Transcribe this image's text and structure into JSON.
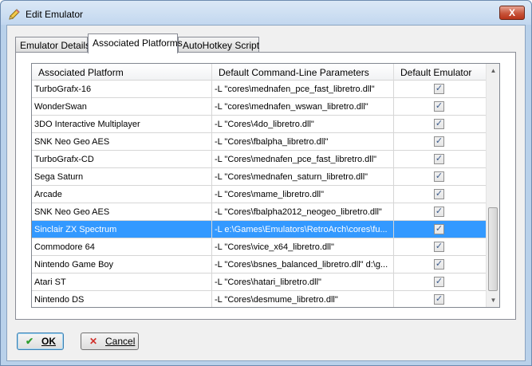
{
  "window": {
    "title": "Edit Emulator",
    "title_icon": "pencil-icon",
    "close_label": "X"
  },
  "tabs": [
    {
      "label": "Emulator Details",
      "active": false
    },
    {
      "label": "Associated Platforms",
      "active": true
    },
    {
      "label": "AutoHotkey Script",
      "active": false
    }
  ],
  "grid": {
    "columns": [
      "Associated Platform",
      "Default Command-Line Parameters",
      "Default Emulator"
    ],
    "rows": [
      {
        "platform": "TurboGrafx-16",
        "params": "-L \"cores\\mednafen_pce_fast_libretro.dll\"",
        "default": true
      },
      {
        "platform": "WonderSwan",
        "params": "-L \"cores\\mednafen_wswan_libretro.dll\"",
        "default": true
      },
      {
        "platform": "3DO Interactive Multiplayer",
        "params": "-L \"Cores\\4do_libretro.dll\"",
        "default": true
      },
      {
        "platform": "SNK Neo Geo AES",
        "params": "-L \"Cores\\fbalpha_libretro.dll\"",
        "default": true
      },
      {
        "platform": "TurboGrafx-CD",
        "params": "-L \"Cores\\mednafen_pce_fast_libretro.dll\"",
        "default": true
      },
      {
        "platform": "Sega Saturn",
        "params": "-L \"Cores\\mednafen_saturn_libretro.dll\"",
        "default": true
      },
      {
        "platform": "Arcade",
        "params": "-L \"Cores\\mame_libretro.dll\"",
        "default": true
      },
      {
        "platform": "SNK Neo Geo AES",
        "params": "-L \"Cores\\fbalpha2012_neogeo_libretro.dll\"",
        "default": true
      },
      {
        "platform": "Sinclair ZX Spectrum",
        "params": "-L e:\\Games\\Emulators\\RetroArch\\cores\\fu...",
        "default": true,
        "selected": true
      },
      {
        "platform": "Commodore 64",
        "params": "-L \"Cores\\vice_x64_libretro.dll\"",
        "default": true
      },
      {
        "platform": "Nintendo Game Boy",
        "params": "-L \"Cores\\bsnes_balanced_libretro.dll\" d:\\g...",
        "default": true
      },
      {
        "platform": "Atari ST",
        "params": "-L \"Cores\\hatari_libretro.dll\"",
        "default": true
      },
      {
        "platform": "Nintendo DS",
        "params": "-L \"Cores\\desmume_libretro.dll\"",
        "default": true
      }
    ]
  },
  "buttons": {
    "ok": {
      "label": "OK",
      "icon": "checkmark-icon"
    },
    "cancel": {
      "label": "Cancel",
      "icon": "x-icon"
    }
  },
  "colors": {
    "selection": "#3399ff",
    "checkmark_green": "#2f9e2f",
    "cancel_red": "#d0302a"
  }
}
